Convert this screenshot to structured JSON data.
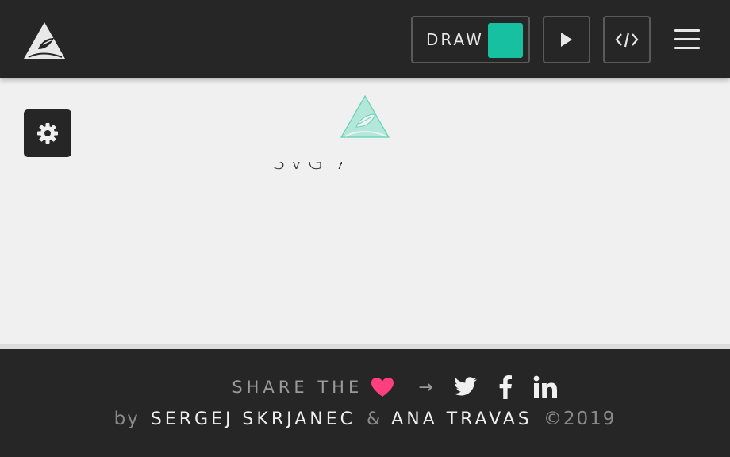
{
  "header": {
    "draw_label": "DRAW",
    "draw_color": "#16c0a0",
    "logo_icon": "mountain-logo-icon",
    "play_icon": "play-icon",
    "code_icon": "code-icon",
    "menu_icon": "hamburger-menu-icon"
  },
  "canvas": {
    "settings_icon": "gear-icon",
    "art_title": "SVG ART",
    "art_logo_icon": "mountain-logo-icon",
    "art_logo_color": "#7fe0c8"
  },
  "footer": {
    "share_text": "SHARE THE",
    "heart_icon": "heart-icon",
    "heart_color": "#ff3f7f",
    "arrow": "→",
    "social_icons": [
      "twitter-icon",
      "facebook-icon",
      "linkedin-icon"
    ],
    "by": "by",
    "author1": "SERGEJ SKRJANEC",
    "amp": "&",
    "author2": "ANA TRAVAS",
    "copyright": "©2019"
  }
}
